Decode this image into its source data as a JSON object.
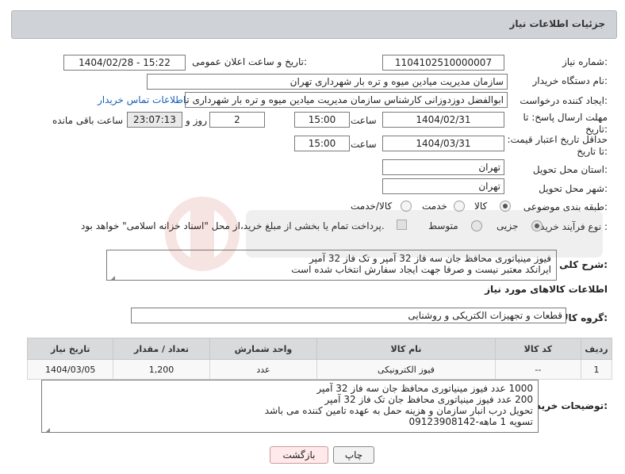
{
  "header": {
    "title": "جزئیات اطلاعات نیاز"
  },
  "need_number": {
    "label": "شماره نیاز:",
    "value": "1104102510000007"
  },
  "announce": {
    "label": "تاریخ و ساعت اعلان عمومی:",
    "value": "1404/02/28 - 15:22"
  },
  "buyer_org": {
    "label": "نام دستگاه خریدار:",
    "value": "سازمان مدیریت میادین میوه و تره بار شهرداری تهران"
  },
  "requester": {
    "label": "ایجاد کننده درخواست:",
    "value": "ابوالفضل دوزدوزانی کارشناس سازمان مدیریت میادین میوه و تره بار شهرداری تهران",
    "contact_link": "اطلاعات تماس خریدار"
  },
  "deadline": {
    "label": "مهلت ارسال پاسخ: تا تاریخ:",
    "date": "1404/02/31",
    "time_label": "ساعت",
    "time": "15:00",
    "days": "2",
    "days_label": "روز و",
    "remaining": "23:07:13",
    "remaining_label": "ساعت باقی مانده"
  },
  "price_validity": {
    "label": "حداقل تاریخ اعتبار قیمت: تا تاریخ:",
    "date": "1404/03/31",
    "time_label": "ساعت",
    "time": "15:00"
  },
  "delivery_province": {
    "label": "استان محل تحویل:",
    "value": "تهران"
  },
  "delivery_city": {
    "label": "شهر محل تحویل:",
    "value": "تهران"
  },
  "category": {
    "label": "طبقه بندی موضوعی:",
    "options": [
      "کالا",
      "خدمت",
      "کالا/خدمت"
    ],
    "selected": "کالا"
  },
  "purchase_type": {
    "label": "نوع فرآیند خرید :",
    "options": [
      "جزیی",
      "متوسط"
    ],
    "selected": "جزیی",
    "payment_note": "پرداخت تمام یا بخشی از مبلغ خرید،از محل \"اسناد خزانه اسلامی\" خواهد بود."
  },
  "summary": {
    "label": "شرح کلی نیاز:",
    "lines": [
      "فیوز مینیاتوری محافظ جان سه فاز 32 آمپر و تک فاز 32 آمپر",
      "ایرانکد معتبر نیست و صرفا جهت ایجاد سفارش انتخاب شده است"
    ]
  },
  "goods_info": {
    "title": "اطلاعات کالاهای مورد نیاز"
  },
  "goods_group": {
    "label": "گروه کالا:",
    "value": "قطعات و تجهیزات الکتریکی و روشنایی"
  },
  "table": {
    "headers": [
      "ردیف",
      "کد کالا",
      "نام کالا",
      "واحد شمارش",
      "تعداد / مقدار",
      "تاریخ نیاز"
    ],
    "rows": [
      {
        "row": "1",
        "code": "--",
        "name": "فیوز الکترونیکی",
        "unit": "عدد",
        "qty": "1,200",
        "date": "1404/03/05"
      }
    ]
  },
  "buyer_notes": {
    "label": "توضیحات خریدار:",
    "lines": [
      "1000 عدد فیوز مینیاتوری محافظ جان سه فاز 32 آمپر",
      "200 عدد فیوز مینیاتوری محافظ جان تک فاز 32 آمپر",
      "تحویل درب انبار سازمان و هزینه حمل به عهده تامین کننده می باشد",
      "تسویه 1 ماهه-09123908142"
    ]
  },
  "buttons": {
    "print": "چاپ",
    "back": "بازگشت"
  }
}
